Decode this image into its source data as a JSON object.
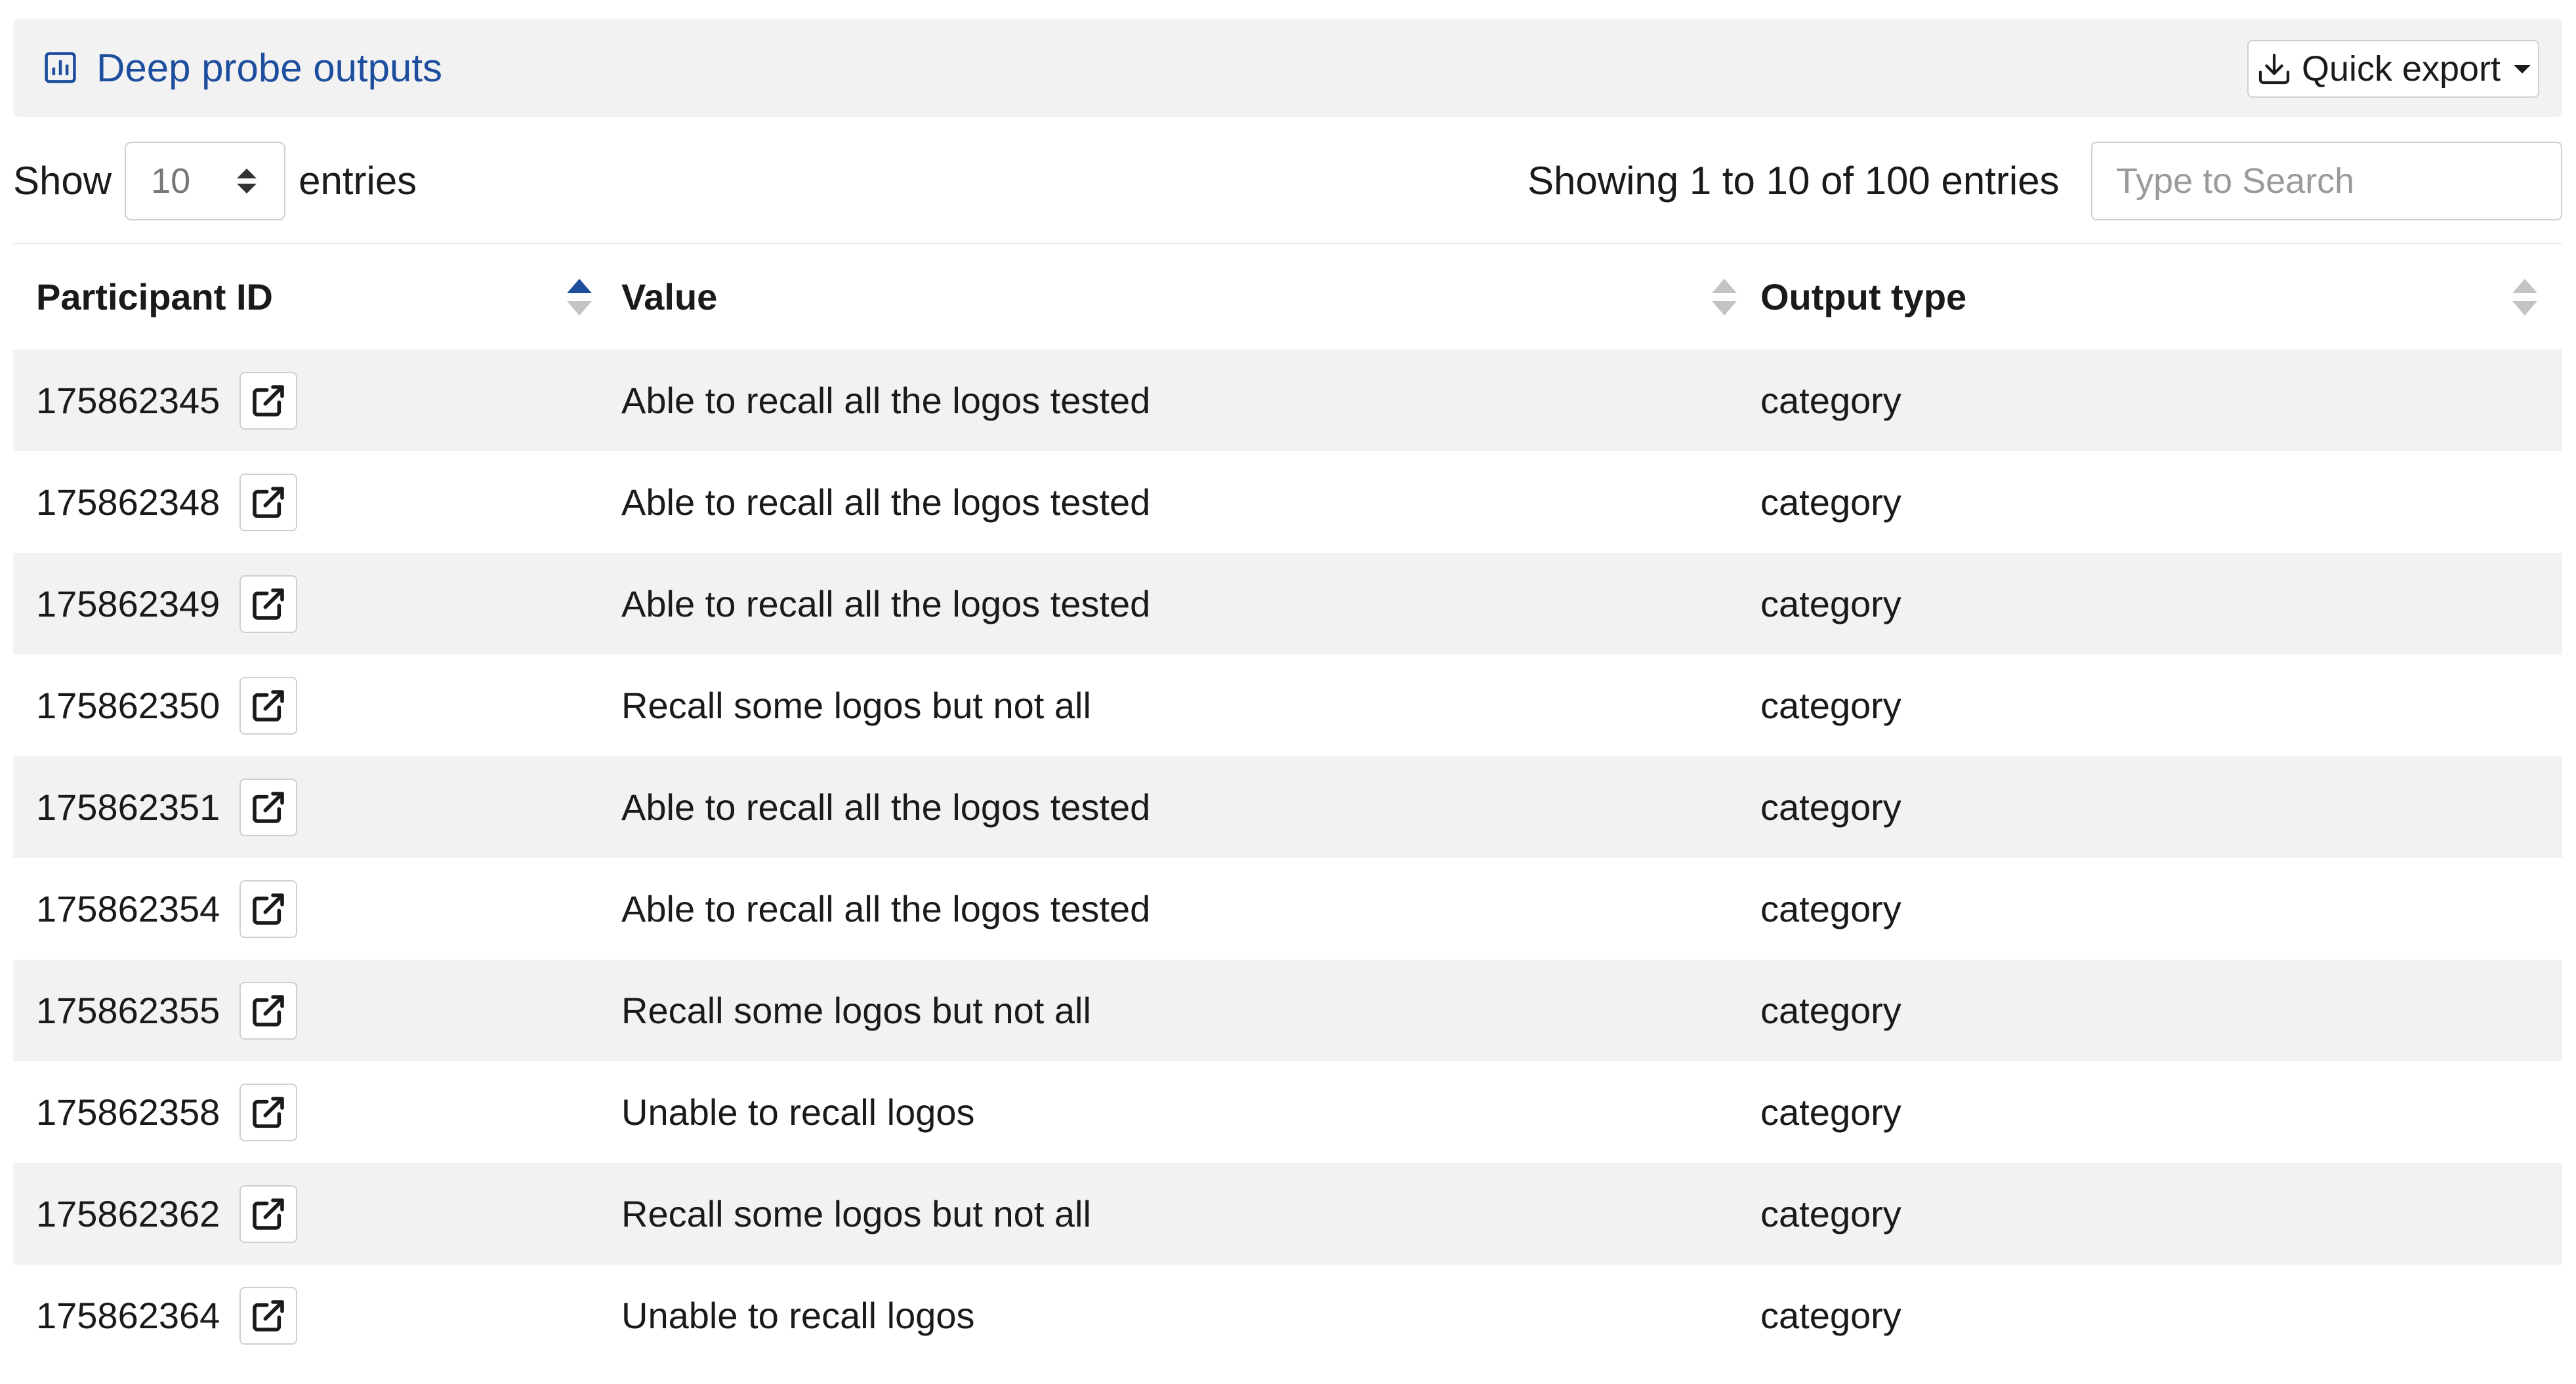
{
  "header": {
    "title": "Deep probe outputs",
    "export_label": "Quick export"
  },
  "controls": {
    "show_label": "Show",
    "page_length": "10",
    "entries_label": "entries",
    "info": "Showing 1 to 10 of 100 entries",
    "search_placeholder": "Type to Search"
  },
  "columns": [
    {
      "label": "Participant ID",
      "sort": "ascending"
    },
    {
      "label": "Value",
      "sort": "none"
    },
    {
      "label": "Output type",
      "sort": "none"
    }
  ],
  "rows": [
    {
      "id": "175862345",
      "value": "Able to recall all the logos tested",
      "type": "category"
    },
    {
      "id": "175862348",
      "value": "Able to recall all the logos tested",
      "type": "category"
    },
    {
      "id": "175862349",
      "value": "Able to recall all the logos tested",
      "type": "category"
    },
    {
      "id": "175862350",
      "value": "Recall some logos but not all",
      "type": "category"
    },
    {
      "id": "175862351",
      "value": "Able to recall all the logos tested",
      "type": "category"
    },
    {
      "id": "175862354",
      "value": "Able to recall all the logos tested",
      "type": "category"
    },
    {
      "id": "175862355",
      "value": "Recall some logos but not all",
      "type": "category"
    },
    {
      "id": "175862358",
      "value": "Unable to recall logos",
      "type": "category"
    },
    {
      "id": "175862362",
      "value": "Recall some logos but not all",
      "type": "category"
    },
    {
      "id": "175862364",
      "value": "Unable to recall logos",
      "type": "category"
    }
  ],
  "icons": {
    "title": "bar-chart-icon",
    "export": "download-icon",
    "row_action": "external-link-icon"
  },
  "colors": {
    "accent": "#1d4e9e",
    "stripe": "#f2f2f2",
    "header_bg": "#f2f2f2"
  }
}
